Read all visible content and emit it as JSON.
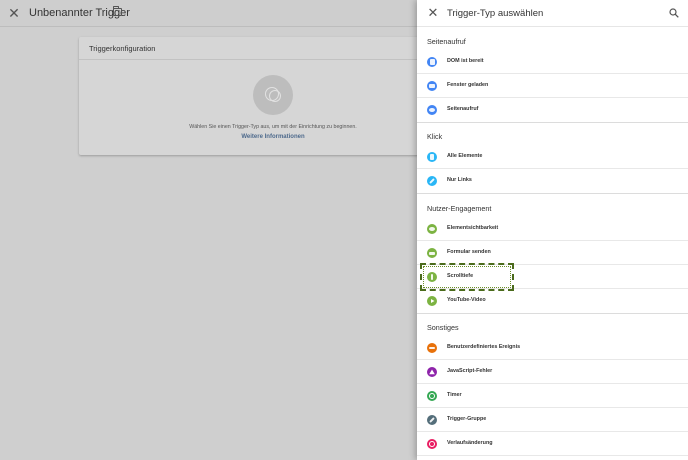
{
  "background": {
    "title": "Unbenannter Trigger",
    "close_icon": "close-icon",
    "folder_icon": "folder-icon",
    "config_card": {
      "title": "Triggerkonfiguration",
      "hint": "Wählen Sie einen Trigger-Typ aus, um mit der Einrichtung zu beginnen.",
      "link": "Weitere Informationen"
    }
  },
  "panel": {
    "title": "Trigger-Typ auswählen",
    "close_icon": "close-icon",
    "search_icon": "search-icon",
    "sections": [
      {
        "label": "Seitenaufruf",
        "items": [
          {
            "label": "DOM ist bereit",
            "icon": "document-icon",
            "color": "#4285f4"
          },
          {
            "label": "Fenster geladen",
            "icon": "window-icon",
            "color": "#4285f4"
          },
          {
            "label": "Seitenaufruf",
            "icon": "eye-icon",
            "color": "#4285f4"
          }
        ]
      },
      {
        "label": "Klick",
        "items": [
          {
            "label": "Alle Elemente",
            "icon": "cursor-icon",
            "color": "#29b6f6"
          },
          {
            "label": "Nur Links",
            "icon": "link-icon",
            "color": "#29b6f6"
          }
        ]
      },
      {
        "label": "Nutzer-Engagement",
        "items": [
          {
            "label": "Elementsichtbarkeit",
            "icon": "visibility-icon",
            "color": "#7cb342"
          },
          {
            "label": "Formular senden",
            "icon": "form-icon",
            "color": "#7cb342"
          },
          {
            "label": "Scrolltiefe",
            "icon": "scroll-icon",
            "color": "#7cb342"
          },
          {
            "label": "YouTube-Video",
            "icon": "play-icon",
            "color": "#7cb342"
          }
        ]
      },
      {
        "label": "Sonstiges",
        "items": [
          {
            "label": "Benutzerdefiniertes Ereignis",
            "icon": "code-icon",
            "color": "#e8710a"
          },
          {
            "label": "JavaScript-Fehler",
            "icon": "warning-icon",
            "color": "#8e24aa"
          },
          {
            "label": "Timer",
            "icon": "timer-icon",
            "color": "#34a853"
          },
          {
            "label": "Trigger-Gruppe",
            "icon": "group-icon",
            "color": "#546e7a"
          },
          {
            "label": "Verlaufsänderung",
            "icon": "history-icon",
            "color": "#e91e63"
          }
        ]
      }
    ]
  }
}
